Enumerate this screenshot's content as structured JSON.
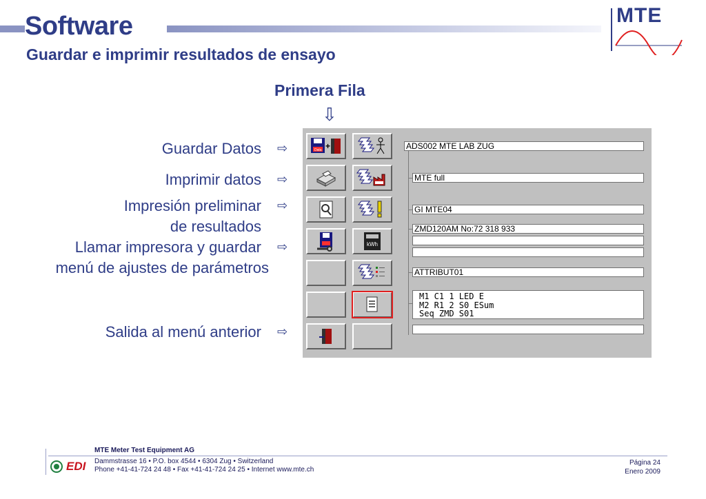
{
  "header": {
    "title": "Software",
    "subtitle": "Guardar e imprimir resultados de ensayo",
    "logo_text": "MTE"
  },
  "column_heading": "Primera Fila",
  "labels": {
    "guardar": "Guardar Datos",
    "imprimir": "Imprimir datos",
    "preliminar_1": "Impresión preliminar",
    "preliminar_2": "de resultados",
    "llamar_1": "Llamar impresora y guardar",
    "llamar_2": "menú de ajustes de parámetros",
    "salida": "Salida al menú anterior"
  },
  "fields": {
    "f1": "ADS002 MTE LAB ZUG",
    "f2": "MTE full",
    "f3": "GI MTE04",
    "f4": "ZMD120AM No:72 318 933",
    "f5": "",
    "f6": "",
    "f7": "ATTRIBUT01",
    "f8": "",
    "f9": ""
  },
  "multiline": {
    "line1": "M1 C1 1 LED E",
    "line2": "M2 R1 2 S0 ESum",
    "line3": "Seq ZMD S01"
  },
  "icons": {
    "data_badge": "Data",
    "kwh_badge": "kWh"
  },
  "footer": {
    "company": "MTE Meter Test Equipment AG",
    "address": "Dammstrasse 16 • P.O. box 4544 • 6304 Zug • Switzerland",
    "contact": "Phone +41-41-724 24 48 • Fax +41-41-724 24 25 • Internet www.mte.ch",
    "page": "Página 24",
    "date": "Enero 2009",
    "edi": "EDI"
  },
  "colors": {
    "brand": "#2f3d87",
    "panel": "#c0c0c0",
    "selection": "#e02020"
  }
}
